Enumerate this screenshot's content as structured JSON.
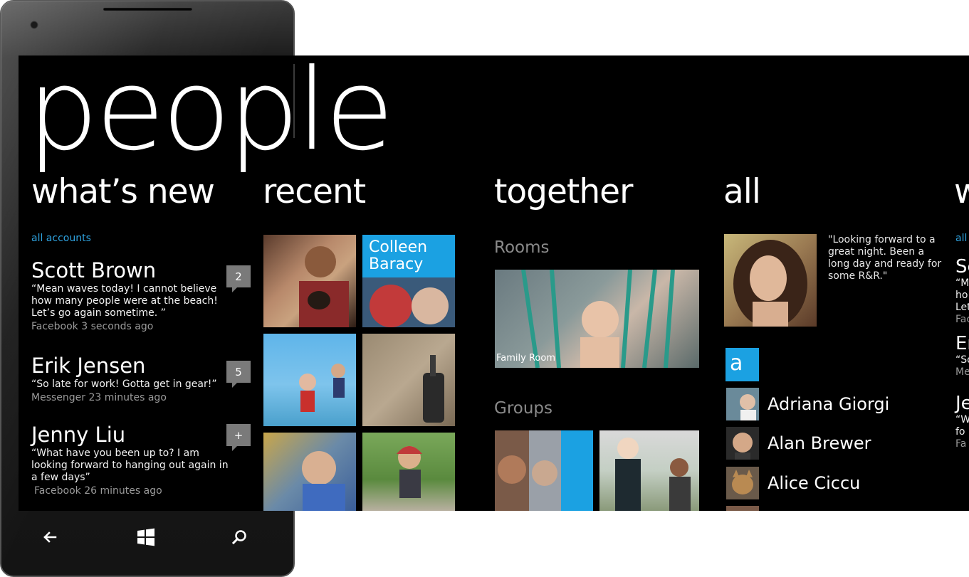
{
  "title": "people",
  "sections": {
    "whats_new": "what’s new",
    "recent": "recent",
    "together": "together",
    "all": "all",
    "next": "w"
  },
  "whats_new": {
    "filter": "all accounts",
    "items": [
      {
        "name": "Scott Brown",
        "badge": "2",
        "message": "“Mean waves today! I cannot believe how many people were at the beach! Let’s go again sometime. ”",
        "meta": "Facebook 3 seconds ago"
      },
      {
        "name": "Erik Jensen",
        "badge": "5",
        "message": "“So late for work! Gotta get in gear!”",
        "meta": "Messenger 23 minutes ago"
      },
      {
        "name": "Jenny Liu",
        "badge": "+",
        "message": "“What have you been up to? I am looking forward to hanging out again in a few days”",
        "meta": "Facebook 26 minutes ago"
      }
    ]
  },
  "recent": {
    "tile_label": "Colleen Baracy"
  },
  "together": {
    "rooms_label": "Rooms",
    "room_caption": "Family Room",
    "groups_label": "Groups"
  },
  "all": {
    "status": "\"Looking forward to a great night. Been a long day and ready for some R&R.\"",
    "letter": "a",
    "contacts": [
      "Adriana Giorgi",
      "Alan Brewer",
      "Alice Ciccu"
    ]
  },
  "peek": {
    "filter": "all",
    "lines": [
      "Sc",
      "“M",
      "ho",
      "Let",
      "Fac",
      "Er",
      "“So",
      "Me",
      "Je",
      "“W",
      "fo",
      "Fa"
    ]
  },
  "colors": {
    "accent": "#2fa3e0",
    "tile": "#1ba1e2",
    "background": "#000000"
  },
  "icons": [
    "back-arrow-icon",
    "windows-logo-icon",
    "search-icon"
  ]
}
